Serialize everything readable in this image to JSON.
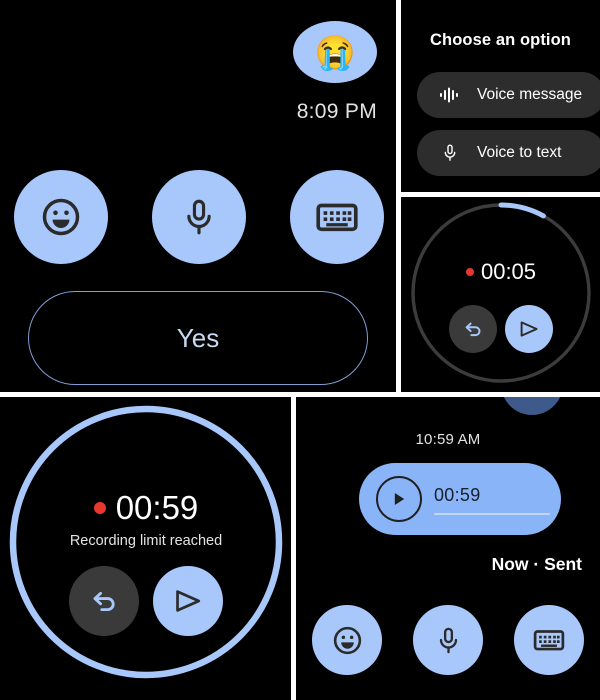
{
  "panels": {
    "quick_reply": {
      "name": "Quick reply screen",
      "incoming_emoji": "😭",
      "message_time": "8:09 PM",
      "actions": [
        {
          "icon": "emoji-icon",
          "label": "Emoji"
        },
        {
          "icon": "microphone-icon",
          "label": "Voice"
        },
        {
          "icon": "keyboard-icon",
          "label": "Keyboard"
        }
      ],
      "suggested_reply": "Yes"
    },
    "choose_option": {
      "title": "Choose an option",
      "options": [
        {
          "label": "Voice message",
          "icon": "waveform-icon"
        },
        {
          "label": "Voice to text",
          "icon": "microphone-icon"
        }
      ]
    },
    "recording_active": {
      "time": "00:05",
      "progress_pct": 8,
      "recording_dot_color": "#e8372b",
      "undo_label": "Undo",
      "send_label": "Send"
    },
    "recording_limit": {
      "time": "00:59",
      "subtitle": "Recording limit reached",
      "progress_pct": 100,
      "recording_dot_color": "#e8372b",
      "undo_label": "Undo",
      "send_label": "Send"
    },
    "sent_message": {
      "conversation_time": "10:59 AM",
      "audio_duration": "00:59",
      "status": "Now · Sent",
      "actions": [
        {
          "icon": "emoji-icon",
          "label": "Emoji"
        },
        {
          "icon": "microphone-icon",
          "label": "Voice"
        },
        {
          "icon": "keyboard-icon",
          "label": "Keyboard"
        }
      ]
    }
  },
  "colors": {
    "accent_blue": "#a8c7fa",
    "bubble_blue": "#8ab4f8",
    "chip_gray": "#2d2d2d",
    "background": "#000000",
    "record_red": "#e8372b"
  }
}
